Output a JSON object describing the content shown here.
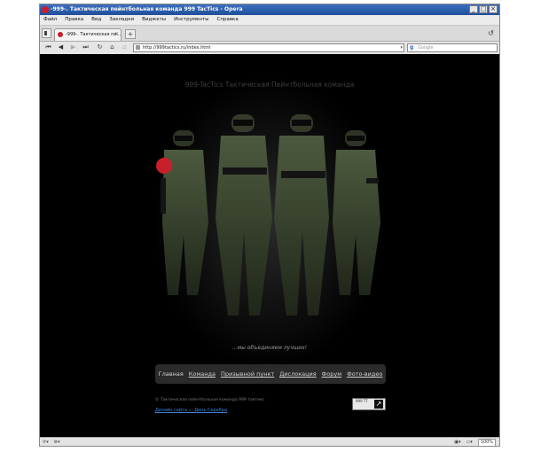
{
  "window": {
    "title": "-999-. Тактическая пейнтбольная команда 999 TacTics - Opera",
    "controls": {
      "minimize": "_",
      "maximize": "□",
      "close": "×"
    }
  },
  "menu": [
    "Файл",
    "Правка",
    "Вид",
    "Закладки",
    "Виджеты",
    "Инструменты",
    "Справка"
  ],
  "tabs": [
    {
      "label": "-999-. Тактическая пе…",
      "active": true
    }
  ],
  "newtab_label": "+",
  "address": {
    "url": "http://999tactics.ru/index.html"
  },
  "search": {
    "placeholder": "Google"
  },
  "page": {
    "site_title": "999-TacTics Тактическая Пейнтбольная команда",
    "slogan": "...мы объединяем лучших!",
    "nav": [
      {
        "label": "Главная",
        "current": true
      },
      {
        "label": "Команда"
      },
      {
        "label": "Призывной пункт"
      },
      {
        "label": "Дислокация"
      },
      {
        "label": "Форум"
      },
      {
        "label": "Фото-видео"
      }
    ],
    "footer": {
      "copyright": "© Тактическая пейнтбольная команда 999 тактикс",
      "design_link": "Дизайн сайта — День Серебра"
    },
    "badge_text": "999 TT"
  },
  "status": {
    "zoom": "100%"
  },
  "colors": {
    "titlebar": "#2a5aa8",
    "page_bg": "#000000",
    "nav_panel": "#2b2b2b",
    "link": "#3d7fd6",
    "accent_red": "#c8202a"
  }
}
